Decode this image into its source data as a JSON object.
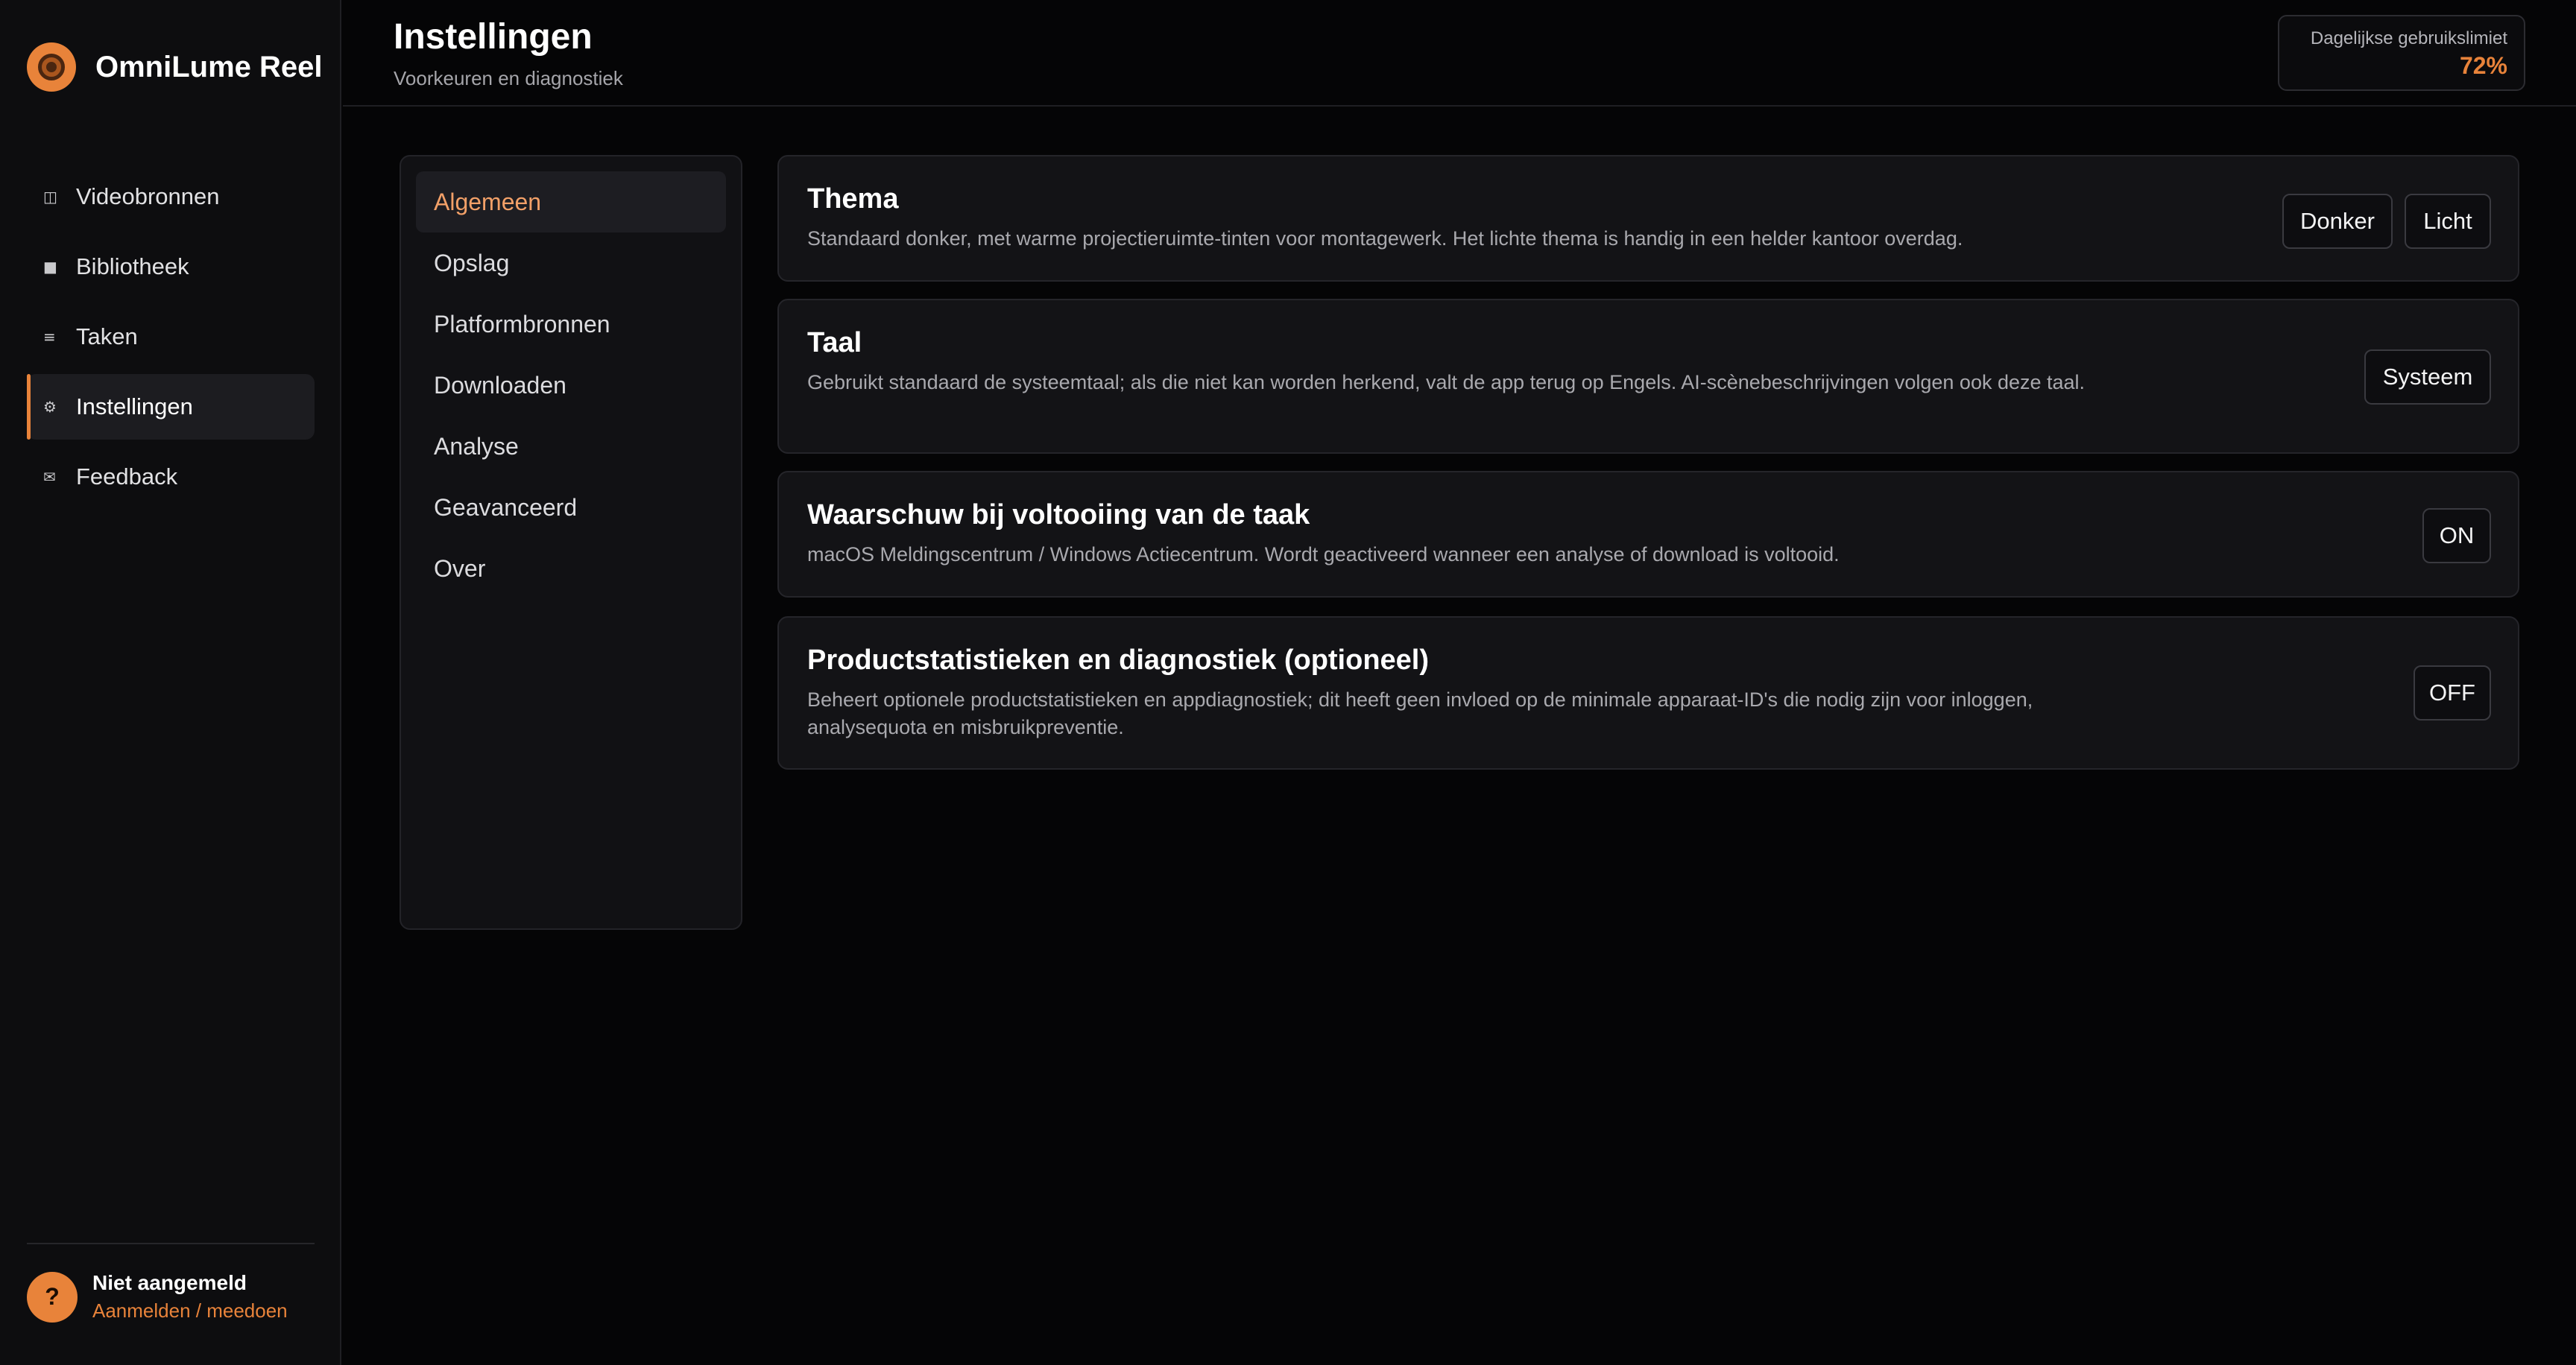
{
  "app": {
    "name": "OmniLume Reel",
    "logo_icon": "film-reel-icon",
    "accent_color": "#e8833a"
  },
  "sidebar": {
    "items": [
      {
        "label": "Videobronnen",
        "icon": "video-sources-icon",
        "glyph": "◫",
        "active": false
      },
      {
        "label": "Bibliotheek",
        "icon": "library-icon",
        "glyph": "■",
        "active": false
      },
      {
        "label": "Taken",
        "icon": "tasks-list-icon",
        "glyph": "≡",
        "active": false
      },
      {
        "label": "Instellingen",
        "icon": "gear-icon",
        "glyph": "⚙",
        "active": true
      },
      {
        "label": "Feedback",
        "icon": "mail-icon",
        "glyph": "✉",
        "active": false
      }
    ],
    "user": {
      "avatar_text": "?",
      "status": "Niet aangemeld",
      "link": "Aanmelden / meedoen"
    }
  },
  "header": {
    "title": "Instellingen",
    "subtitle": "Voorkeuren en diagnostiek",
    "usage": {
      "label": "Dagelijkse gebruikslimiet",
      "value": "72%"
    }
  },
  "subnav": {
    "items": [
      {
        "label": "Algemeen",
        "active": true
      },
      {
        "label": "Opslag",
        "active": false
      },
      {
        "label": "Platformbronnen",
        "active": false
      },
      {
        "label": "Downloaden",
        "active": false
      },
      {
        "label": "Analyse",
        "active": false
      },
      {
        "label": "Geavanceerd",
        "active": false
      },
      {
        "label": "Over",
        "active": false
      }
    ]
  },
  "settings": {
    "theme": {
      "title": "Thema",
      "description": "Standaard donker, met warme projectieruimte-tinten voor montagewerk. Het lichte thema is handig in een helder kantoor overdag.",
      "dark_label": "Donker",
      "light_label": "Licht"
    },
    "language": {
      "title": "Taal",
      "description": "Gebruikt standaard de systeemtaal; als die niet kan worden herkend, valt de app terug op Engels. AI-scènebeschrijvingen volgen ook deze taal.",
      "value": "Systeem"
    },
    "notify": {
      "title": "Waarschuw bij voltooiing van de taak",
      "description": "macOS Meldingscentrum / Windows Actiecentrum. Wordt geactiveerd wanneer een analyse of download is voltooid.",
      "value": "ON"
    },
    "analytics": {
      "title": "Productstatistieken en diagnostiek (optioneel)",
      "description": "Beheert optionele productstatistieken en appdiagnostiek; dit heeft geen invloed op de minimale apparaat-ID's die nodig zijn voor inloggen, analysequota en misbruikpreventie.",
      "value": "OFF"
    }
  }
}
